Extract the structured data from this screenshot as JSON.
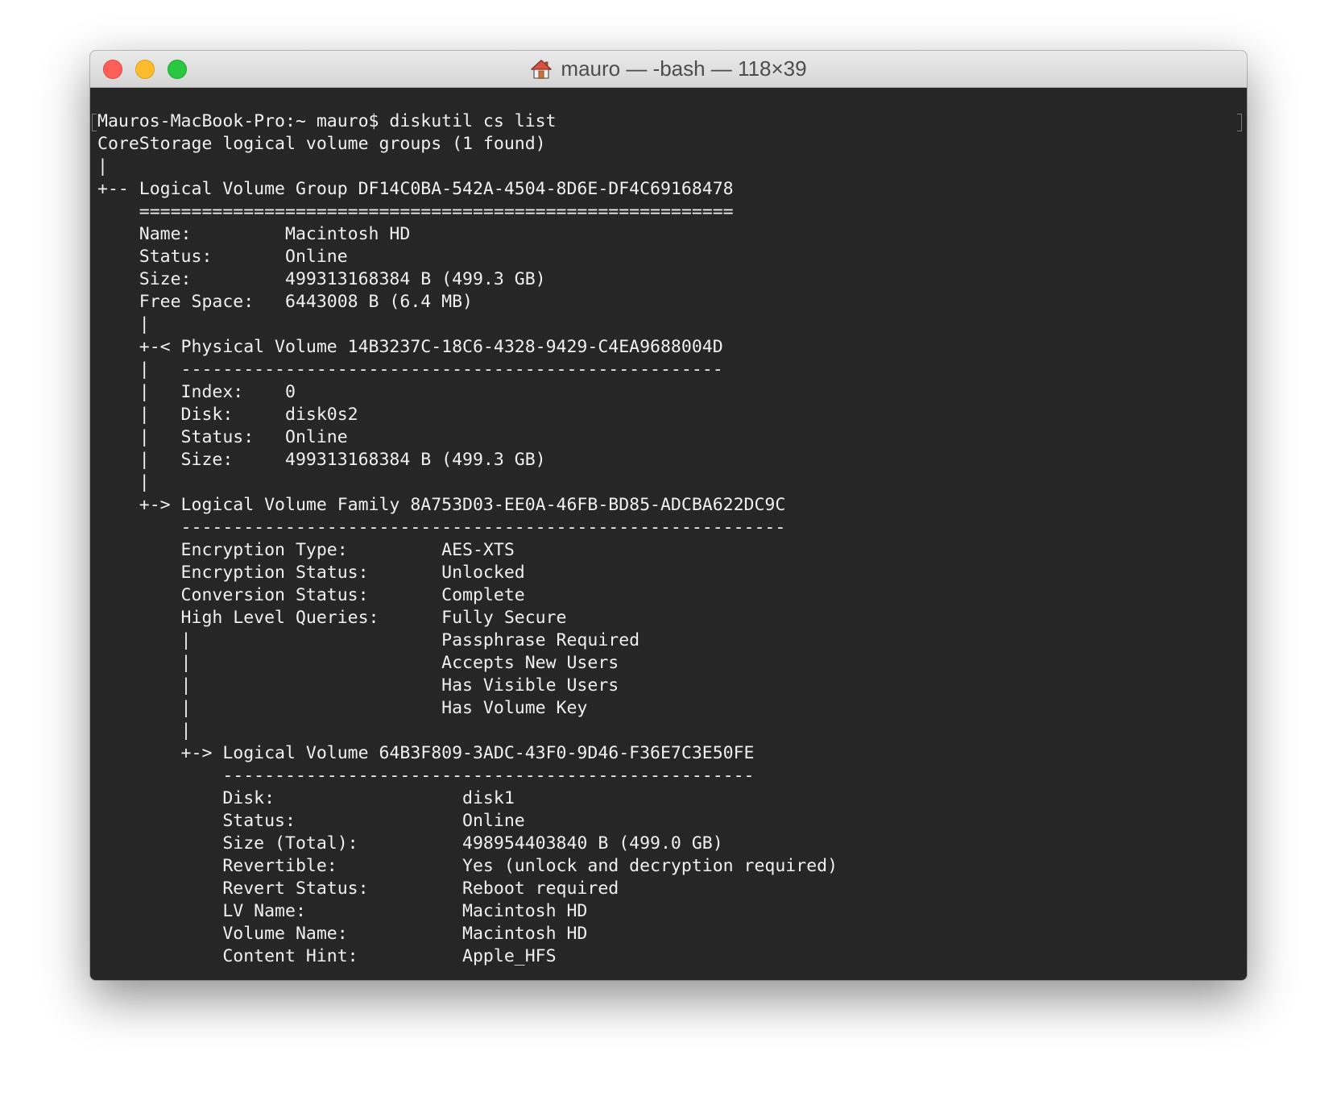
{
  "window": {
    "title": "mauro — -bash — 118×39",
    "colors": {
      "close": "#fc5f57",
      "minimize": "#fdbc2e",
      "zoom": "#29c840",
      "terminal_bg": "#262626",
      "terminal_fg": "#f0f0f0"
    },
    "icons": {
      "title_icon": "home-icon"
    }
  },
  "terminal": {
    "lines": [
      "Mauros-MacBook-Pro:~ mauro$ diskutil cs list",
      "CoreStorage logical volume groups (1 found)",
      "|",
      "+-- Logical Volume Group DF14C0BA-542A-4504-8D6E-DF4C69168478",
      "    =========================================================",
      "    Name:         Macintosh HD",
      "    Status:       Online",
      "    Size:         499313168384 B (499.3 GB)",
      "    Free Space:   6443008 B (6.4 MB)",
      "    |",
      "    +-< Physical Volume 14B3237C-18C6-4328-9429-C4EA9688004D",
      "    |   ----------------------------------------------------",
      "    |   Index:    0",
      "    |   Disk:     disk0s2",
      "    |   Status:   Online",
      "    |   Size:     499313168384 B (499.3 GB)",
      "    |",
      "    +-> Logical Volume Family 8A753D03-EE0A-46FB-BD85-ADCBA622DC9C",
      "        ----------------------------------------------------------",
      "        Encryption Type:         AES-XTS",
      "        Encryption Status:       Unlocked",
      "        Conversion Status:       Complete",
      "        High Level Queries:      Fully Secure",
      "        |                        Passphrase Required",
      "        |                        Accepts New Users",
      "        |                        Has Visible Users",
      "        |                        Has Volume Key",
      "        |",
      "        +-> Logical Volume 64B3F809-3ADC-43F0-9D46-F36E7C3E50FE",
      "            ---------------------------------------------------",
      "            Disk:                  disk1",
      "            Status:                Online",
      "            Size (Total):          498954403840 B (499.0 GB)",
      "            Revertible:            Yes (unlock and decryption required)",
      "            Revert Status:         Reboot required",
      "            LV Name:               Macintosh HD",
      "            Volume Name:           Macintosh HD",
      "            Content Hint:          Apple_HFS"
    ]
  }
}
